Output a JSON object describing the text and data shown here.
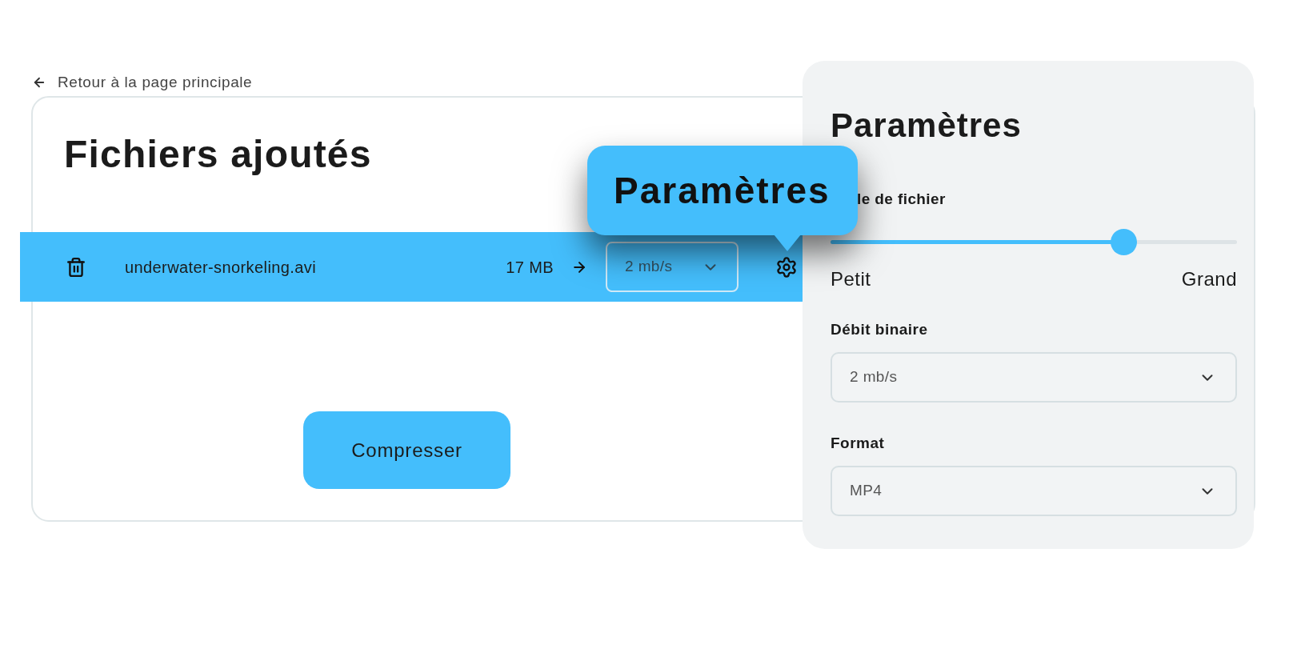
{
  "back_link": {
    "label": "Retour à la page principale"
  },
  "files_card": {
    "title": "Fichiers ajoutés",
    "files": [
      {
        "name": "underwater-snorkeling.avi",
        "size": "17 MB",
        "bitrate": "2 mb/s",
        "selected": true
      }
    ],
    "compress_button": "Compresser"
  },
  "tooltip": {
    "text": "Paramètres"
  },
  "settings_panel": {
    "title": "Paramètres",
    "fields": [
      {
        "kind": "slider",
        "label": "le de fichier",
        "level": 0.72,
        "min_label": "Petit",
        "max_label": "Grand"
      },
      {
        "kind": "select",
        "label": "Débit binaire",
        "value": "2 mb/s"
      },
      {
        "kind": "select",
        "label": "Format",
        "value": "MP4"
      }
    ]
  }
}
